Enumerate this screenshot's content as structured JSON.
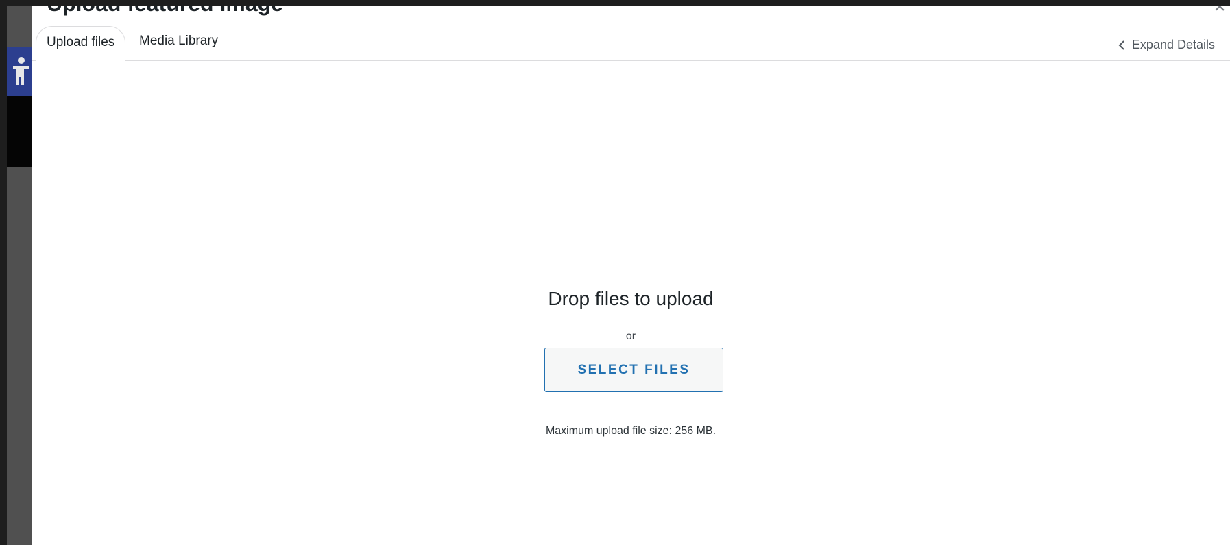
{
  "modal": {
    "title": "Upload featured image",
    "close_symbol": "×"
  },
  "router": {
    "tabs": [
      {
        "label": "Upload files",
        "active": true
      },
      {
        "label": "Media Library",
        "active": false
      }
    ],
    "expand_details_label": "Expand Details"
  },
  "uploader": {
    "drop_title": "Drop files to upload",
    "or_text": "or",
    "select_button_label": "SELECT FILES",
    "max_size_text": "Maximum upload file size: 256 MB."
  },
  "colors": {
    "accent": "#2271b1",
    "background": "#1e1e1e",
    "accessibility_button": "#2c3f8f"
  },
  "icons": {
    "close": "close-icon",
    "expand": "chevron-left-icon",
    "accessibility": "accessibility-icon"
  }
}
